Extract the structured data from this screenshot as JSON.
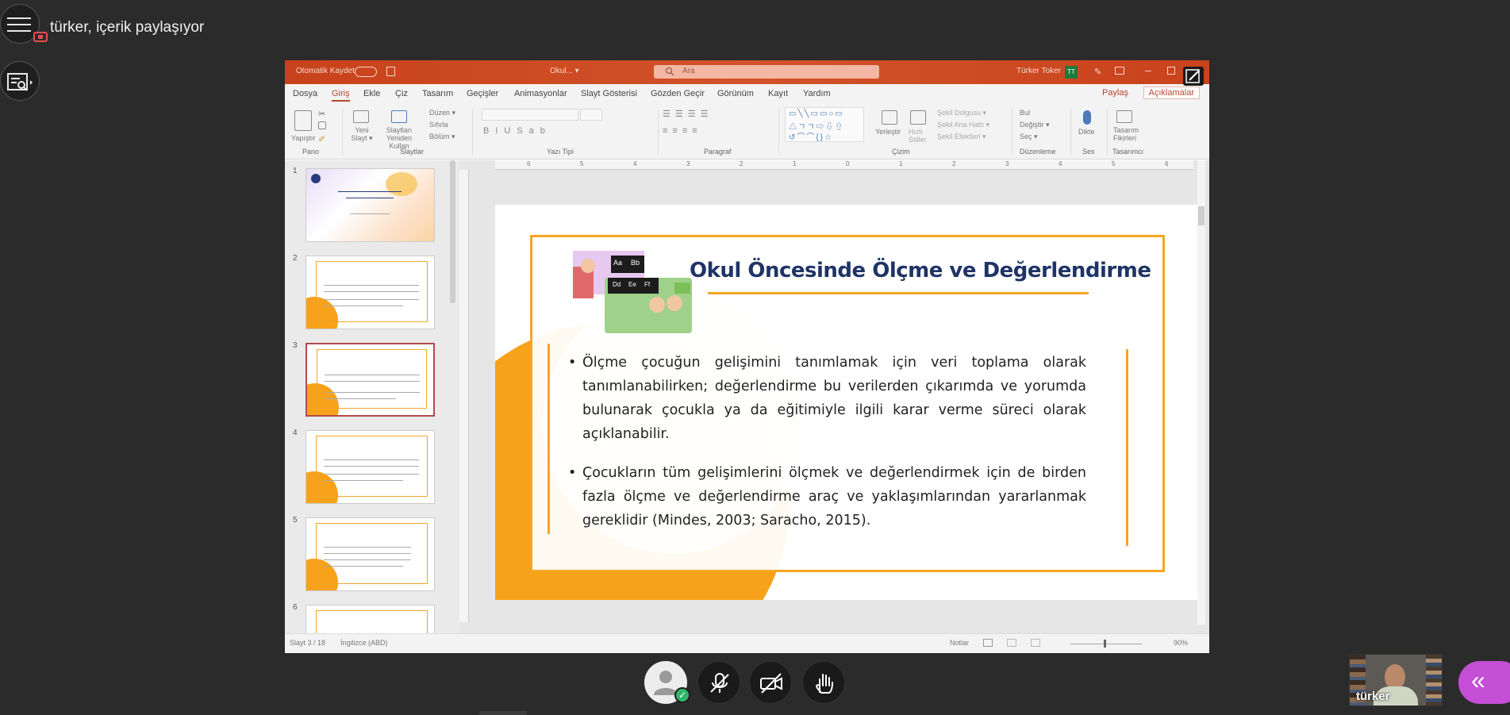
{
  "conference": {
    "presenter_label": "türker, içerik paylaşıyor",
    "self_name": "türker",
    "accent_purple": "#c44ed6",
    "status_green": "#2fb86a"
  },
  "ppt": {
    "titlebar": {
      "autosave": "Otomatik Kaydet",
      "filename": "Okul... ▾",
      "search": "Ara",
      "user": "Türker Toker",
      "user_initials": "TT"
    },
    "menu": [
      "Dosya",
      "Giriş",
      "Ekle",
      "Çiz",
      "Tasarım",
      "Geçişler",
      "Animasyonlar",
      "Slayt Gösterisi",
      "Gözden Geçir",
      "Görünüm",
      "Kayıt",
      "Yardım"
    ],
    "share": "Paylaş",
    "comments": "Açıklamalar",
    "ribbon": {
      "paste": "Yapıştır",
      "new_slide": "Yeni Slayt ▾",
      "reuse": "Slaytları Yeniden Kullan",
      "layout": "Düzen ▾",
      "reset": "Sıfırla",
      "section": "Bölüm ▾",
      "arrange": "Yerleştir",
      "quick_styles": "Hızlı Stiller",
      "shape_fill": "Şekil Dolgusu ▾",
      "shape_outline": "Şekil Ana Hattı ▾",
      "shape_effects": "Şekil Efektleri ▾",
      "find": "Bul",
      "replace": "Değiştir ▾",
      "select": "Seç ▾",
      "dictate": "Dikte",
      "designer": "Tasarım Fikirleri",
      "groups": [
        "Pano",
        "Slaytlar",
        "Yazı Tipi",
        "Paragraf",
        "Çizim",
        "Düzenleme",
        "Ses",
        "Tasarımcı"
      ]
    },
    "thumb_numbers": [
      "1",
      "2",
      "3",
      "4",
      "5",
      "6"
    ],
    "ruler": [
      "6",
      "5",
      "4",
      "3",
      "2",
      "1",
      "0",
      "1",
      "2",
      "3",
      "4",
      "5",
      "6"
    ],
    "slide": {
      "title": "Okul Öncesinde Ölçme ve Değerlendirme",
      "bullet1": "Ölçme çocuğun gelişimini tanımlamak için veri toplama olarak tanımlanabilirken; değerlendirme bu verilerden çıkarımda ve yorumda bulunarak çocukla ya da eğitimiyle ilgili karar verme süreci olarak açıklanabilir.",
      "bullet2": "Çocukların tüm gelişimlerini ölçmek ve değerlendirmek için de birden fazla ölçme ve değerlendirme araç ve yaklaşımlarından yararlanmak gereklidir (Mindes, 2003; Saracho, 2015).",
      "image_letters": [
        "Aa",
        "Bb",
        "Dd",
        "Ee",
        "Ff"
      ]
    },
    "status": {
      "slide_count": "Slayt 3 / 18",
      "language": "İngilizce (ABD)",
      "notes": "Notlar",
      "zoom": "90%"
    }
  }
}
